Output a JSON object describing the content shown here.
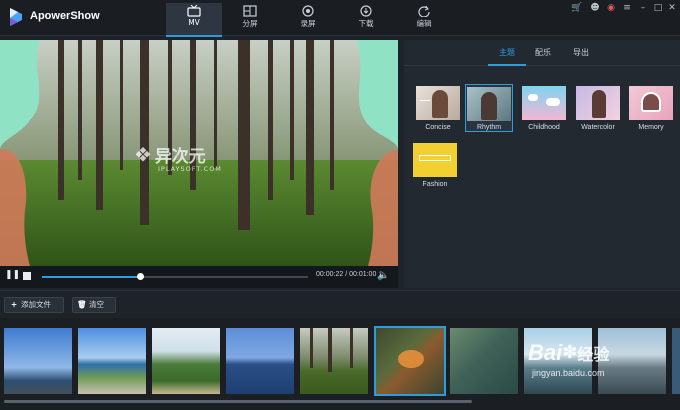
{
  "app": {
    "title": "ApowerShow"
  },
  "nav_tabs": [
    {
      "label": "MV",
      "icon": "tv-icon"
    },
    {
      "label": "分屏",
      "icon": "split-screen-icon"
    },
    {
      "label": "录屏",
      "icon": "record-icon"
    },
    {
      "label": "下载",
      "icon": "download-icon"
    },
    {
      "label": "编辑",
      "icon": "refresh-edit-icon"
    }
  ],
  "window_controls": [
    "cart-icon",
    "user-icon",
    "notification-icon",
    "menu-icon",
    "minimize-icon",
    "maximize-icon",
    "close-icon"
  ],
  "player": {
    "current_time": "00:00:22",
    "total_time": "00:01:00",
    "time_text": "00:00:22 / 00:01:00",
    "progress": 0.37
  },
  "overlay_watermark": {
    "cn": "异次元",
    "en": "IPLAYSOFT.COM"
  },
  "right_tabs": [
    {
      "label": "主题"
    },
    {
      "label": "配乐"
    },
    {
      "label": "导出"
    }
  ],
  "themes": [
    {
      "label": "Concise",
      "selected": false
    },
    {
      "label": "Rhythm",
      "selected": true
    },
    {
      "label": "Childhood",
      "selected": false
    },
    {
      "label": "Watercolor",
      "selected": false
    },
    {
      "label": "Memory",
      "selected": false
    },
    {
      "label": "Fashion",
      "selected": false
    }
  ],
  "toolbar": {
    "add_file": "添加文件",
    "clear": "清空"
  },
  "clips_count_visible": 9,
  "selected_clip_index": 5,
  "site_watermark": {
    "brand": "Bai",
    "brand2": "经验",
    "url": "jingyan.baidu.com"
  },
  "colors": {
    "accent": "#2d9cdb",
    "background": "#1e2329",
    "panel": "#232931"
  }
}
